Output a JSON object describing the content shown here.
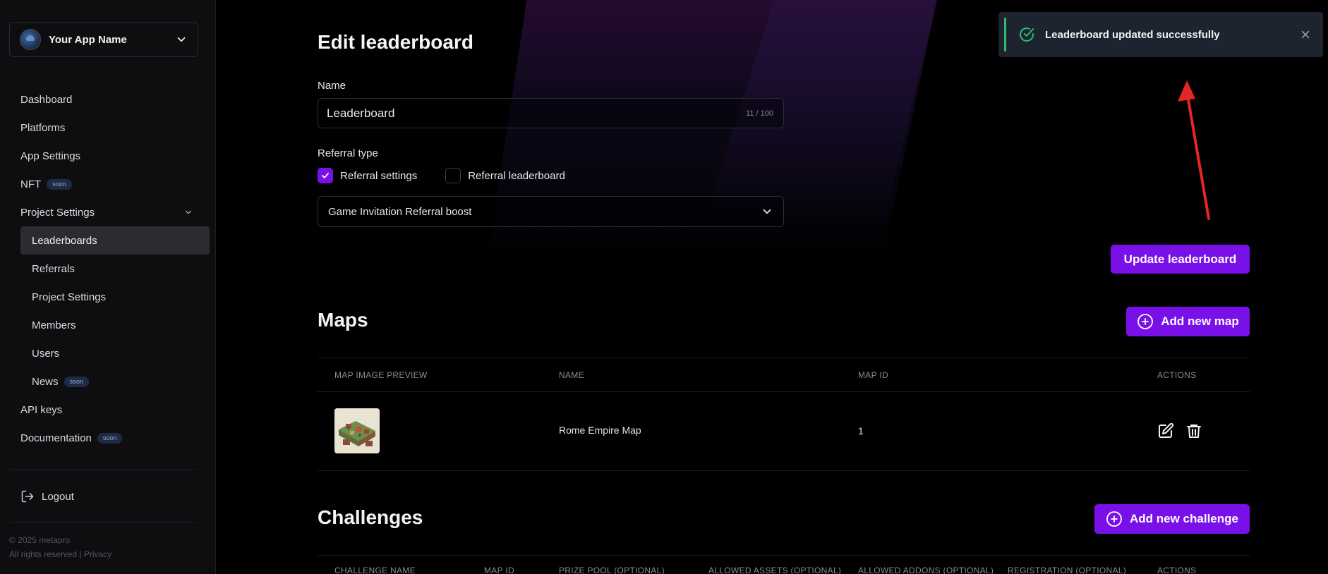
{
  "sidebar": {
    "app_name": "Your App Name",
    "items": [
      {
        "label": "Dashboard"
      },
      {
        "label": "Platforms"
      },
      {
        "label": "App Settings"
      },
      {
        "label": "NFT",
        "badge": "soon"
      },
      {
        "label": "Project Settings"
      },
      {
        "label": "Leaderboards"
      },
      {
        "label": "Referrals"
      },
      {
        "label": "Project Settings"
      },
      {
        "label": "Members"
      },
      {
        "label": "Users"
      },
      {
        "label": "News",
        "badge": "soon"
      },
      {
        "label": "API keys"
      },
      {
        "label": "Documentation",
        "badge": "soon"
      }
    ],
    "logout": "Logout",
    "copyright": "© 2025 metapro",
    "rights": "All rights reserved | Privacy"
  },
  "form": {
    "title": "Edit leaderboard",
    "name_label": "Name",
    "name_value": "Leaderboard",
    "name_counter": "11 / 100",
    "referral_label": "Referral type",
    "opt_settings": "Referral settings",
    "opt_leaderboard": "Referral leaderboard",
    "select_value": "Game Invitation Referral boost",
    "update_button": "Update leaderboard"
  },
  "maps": {
    "title": "Maps",
    "add_button": "Add new map",
    "headers": [
      "MAP IMAGE PREVIEW",
      "NAME",
      "MAP ID",
      "ACTIONS"
    ],
    "rows": [
      {
        "name": "Rome Empire Map",
        "id": "1"
      }
    ]
  },
  "challenges": {
    "title": "Challenges",
    "add_button": "Add new challenge",
    "headers": [
      "CHALLENGE NAME",
      "MAP ID",
      "PRIZE POOL (OPTIONAL)",
      "ALLOWED ASSETS (OPTIONAL)",
      "ALLOWED ADDONS (OPTIONAL)",
      "REGISTRATION (OPTIONAL)",
      "ACTIONS"
    ]
  },
  "toast": {
    "message": "Leaderboard updated successfully"
  },
  "colors": {
    "accent": "#7a10e8",
    "success": "#2fbf6a",
    "annotation_arrow": "#e32626"
  }
}
